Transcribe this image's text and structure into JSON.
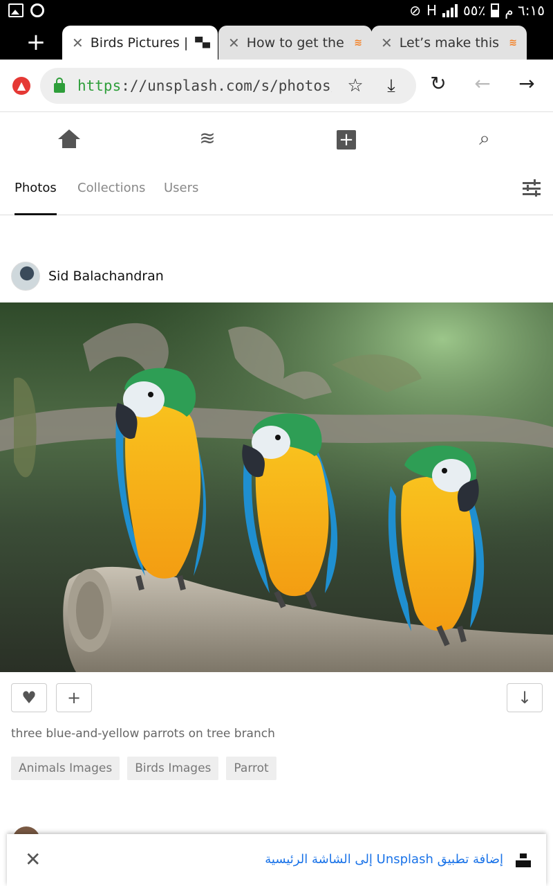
{
  "status_bar": {
    "battery": "٥٥٪",
    "time": "٦:١٥ م",
    "network": "H"
  },
  "tabs": [
    {
      "title": "Birds Pictures |",
      "active": true
    },
    {
      "title": "How to get the",
      "active": false
    },
    {
      "title": "Let’s make this",
      "active": false
    }
  ],
  "address_bar": {
    "url_scheme": "https",
    "url_rest": "://unsplash.com/s/photos/bird"
  },
  "app_nav": {
    "icons": [
      "home-icon",
      "layers-icon",
      "add-box-icon",
      "search-icon"
    ]
  },
  "subtabs": [
    {
      "label": "Photos",
      "active": true
    },
    {
      "label": "Collections",
      "active": false
    },
    {
      "label": "Users",
      "active": false
    }
  ],
  "post": {
    "author": "Sid Balachandran",
    "description": "three blue-and-yellow parrots on tree branch",
    "tags": [
      "Animals Images",
      "Birds Images",
      "Parrot"
    ]
  },
  "banner": {
    "message": "إضافة تطبيق Unsplash إلى الشاشة الرئيسية"
  },
  "colors": {
    "accent_green": "#2e9e3a",
    "link_blue": "#1a73e8",
    "macaw_blue": "#1f8fd0",
    "macaw_yellow": "#f7b11a"
  }
}
